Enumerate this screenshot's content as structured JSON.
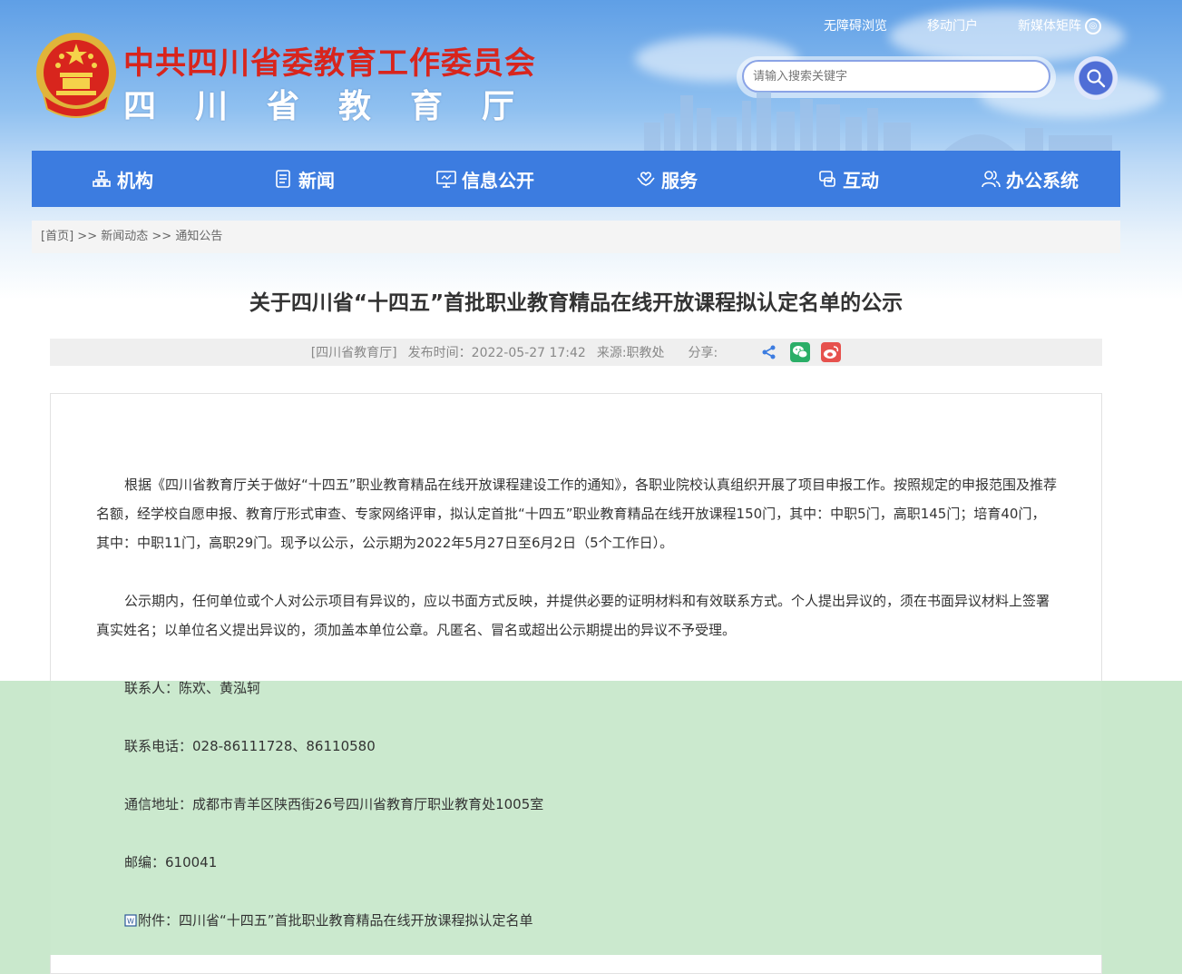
{
  "header": {
    "org_name": "中共四川省委教育工作委员会",
    "dept_name": "四川省教育厅",
    "top_links": [
      "无障碍浏览",
      "移动门户",
      "新媒体矩阵"
    ],
    "search_placeholder": "请输入搜索关键字"
  },
  "nav": {
    "items": [
      {
        "label": "机构",
        "icon": "org-icon"
      },
      {
        "label": "新闻",
        "icon": "news-icon"
      },
      {
        "label": "信息公开",
        "icon": "monitor-icon"
      },
      {
        "label": "服务",
        "icon": "hands-icon"
      },
      {
        "label": "互动",
        "icon": "chat-icon"
      },
      {
        "label": "办公系统",
        "icon": "users-icon"
      }
    ]
  },
  "breadcrumb": {
    "home": "[首页]",
    "sep": ">>",
    "level1": "新闻动态",
    "level2": "通知公告"
  },
  "article": {
    "title": "关于四川省“十四五”首批职业教育精品在线开放课程拟认定名单的公示",
    "source": "[四川省教育厅]",
    "publish_time": "发布时间：2022-05-27 17:42",
    "origin": "来源:职教处",
    "share_label": "分享:",
    "paragraph1": "根据《四川省教育厅关于做好“十四五”职业教育精品在线开放课程建设工作的通知》，各职业院校认真组织开展了项目申报工作。按照规定的申报范围及推荐名额，经学校自愿申报、教育厅形式审查、专家网络评审，拟认定首批“十四五”职业教育精品在线开放课程150门，其中：中职5门，高职145门；培育40门，其中：中职11门，高职29门。现予以公示，公示期为2022年5月27日至6月2日（5个工作日）。",
    "paragraph2": "公示期内，任何单位或个人对公示项目有异议的，应以书面方式反映，并提供必要的证明材料和有效联系方式。个人提出异议的，须在书面异议材料上签署真实姓名；以单位名义提出异议的，须加盖本单位公章。凡匿名、冒名或超出公示期提出的异议不予受理。",
    "contact": "联系人：陈欢、黄泓轲",
    "phone": "联系电话：028-86111728、86110580",
    "address": "通信地址：成都市青羊区陕西街26号四川省教育厅职业教育处1005室",
    "postcode": "邮编：610041",
    "attachment": "附件：四川省“十四五”首批职业教育精品在线开放课程拟认定名单"
  },
  "colors": {
    "nav_bg": "#3c7ce0",
    "title_red": "#d8251d",
    "overlay_green": "#c9e8cc",
    "wechat_green": "#2aae67",
    "weibo_red": "#e6514d",
    "share_blue": "#3c7ce0"
  }
}
